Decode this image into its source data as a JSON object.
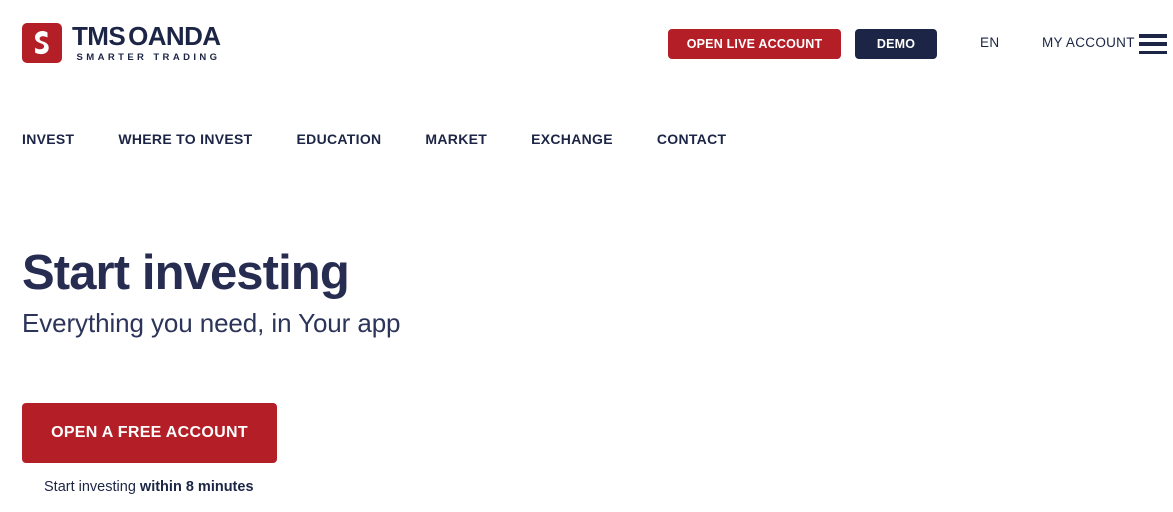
{
  "colors": {
    "brand_red": "#b41f27",
    "brand_navy": "#1c2545",
    "page_background": "#ffffff",
    "text_navy": "#272d51"
  },
  "header": {
    "logo": {
      "mark_icon": "tms-oanda-s-mark-icon",
      "title_part_one": "TMS",
      "title_part_two": "OANDA",
      "tagline": "SMARTER TRADING"
    },
    "open_live_account_label": "OPEN LIVE ACCOUNT",
    "demo_label": "DEMO",
    "language_label": "EN",
    "my_account_label": "MY ACCOUNT",
    "menu_icon": "hamburger-menu-icon"
  },
  "nav": {
    "items": [
      {
        "label": "INVEST"
      },
      {
        "label": "WHERE TO INVEST"
      },
      {
        "label": "EDUCATION"
      },
      {
        "label": "MARKET"
      },
      {
        "label": "EXCHANGE"
      },
      {
        "label": "CONTACT"
      }
    ]
  },
  "hero": {
    "title": "Start investing",
    "subtitle": "Everything you need, in Your app",
    "cta_label": "OPEN A FREE ACCOUNT",
    "note_regular": "Start investing ",
    "note_bold": "within 8 minutes"
  }
}
